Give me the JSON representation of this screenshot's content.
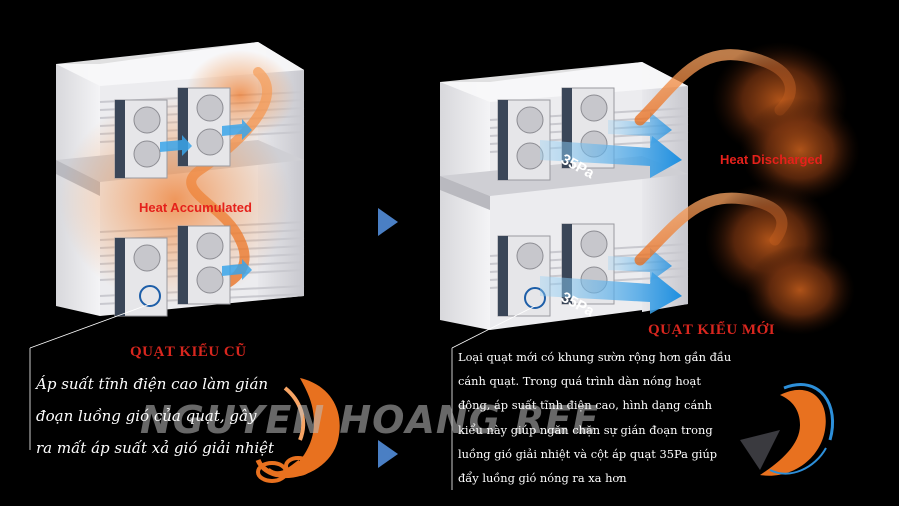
{
  "labels": {
    "heat_accumulated": "Heat Accumulated",
    "heat_discharged": "Heat Discharged",
    "pressure_top": "35Pa",
    "pressure_bottom": "35Pa"
  },
  "old_fan": {
    "title": "QUẠT KIỂU CŨ",
    "description": "Áp suất tĩnh điện cao làm gián đoạn luồng gió của quạt, gây ra mất áp suất xả gió giải nhiệt"
  },
  "new_fan": {
    "title": "QUẠT KIỂU MỚI",
    "description": "Loại quạt mới có khung sườn rộng hơn gần đầu cánh quạt. Trong quá trình dàn nóng hoạt động, áp suất tĩnh điện cao, hình dạng cánh kiểu này giúp ngăn chặn sự gián đoạn trong luồng gió giải nhiệt và cột áp quạt 35Pa giúp đẩy luồng gió nóng ra xa hơn"
  },
  "watermark": "NGUYEN HOANG REE",
  "colors": {
    "background": "#000000",
    "title_red": "#d8261e",
    "label_red": "#e5211b",
    "arrow_blue": "#1e90e0",
    "arrow_nav": "#4a7fc4",
    "heat_orange": "#f07a2a"
  },
  "icons": [
    "next-arrow-icon",
    "fan-blade-old-icon",
    "fan-blade-new-icon"
  ]
}
